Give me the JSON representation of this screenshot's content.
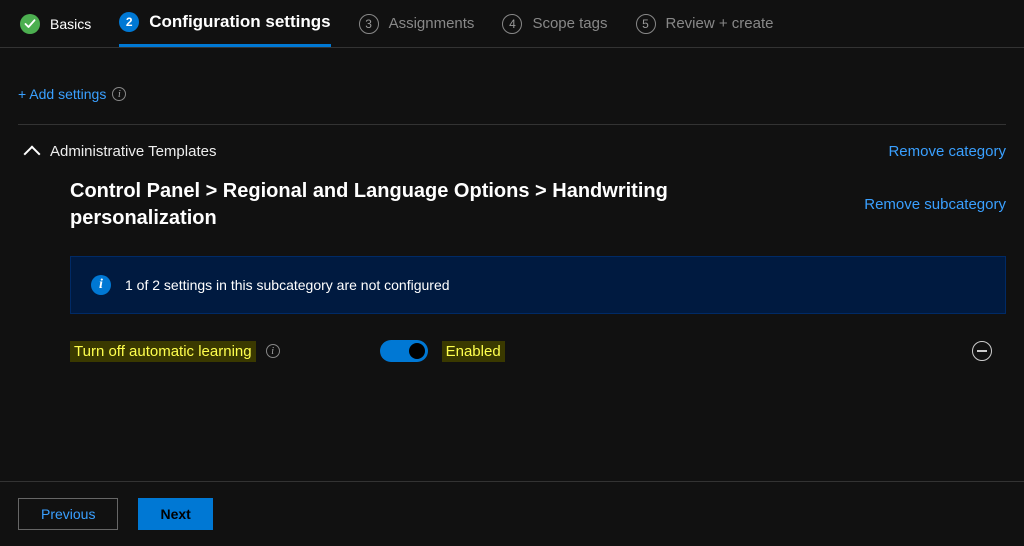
{
  "tabs": [
    {
      "label": "Basics",
      "state": "completed"
    },
    {
      "num": "2",
      "label": "Configuration settings",
      "state": "active"
    },
    {
      "num": "3",
      "label": "Assignments",
      "state": "pending"
    },
    {
      "num": "4",
      "label": "Scope tags",
      "state": "pending"
    },
    {
      "num": "5",
      "label": "Review + create",
      "state": "pending"
    }
  ],
  "actions": {
    "add_settings": "+ Add settings",
    "remove_category": "Remove category",
    "remove_subcategory": "Remove subcategory"
  },
  "category": {
    "title": "Administrative Templates",
    "subcategory_title": "Control Panel > Regional and Language Options > Handwriting personalization"
  },
  "banner": {
    "text": "1 of 2 settings in this subcategory are not configured"
  },
  "setting": {
    "label": "Turn off automatic learning",
    "state_text": "Enabled",
    "enabled": true
  },
  "footer": {
    "previous": "Previous",
    "next": "Next"
  }
}
